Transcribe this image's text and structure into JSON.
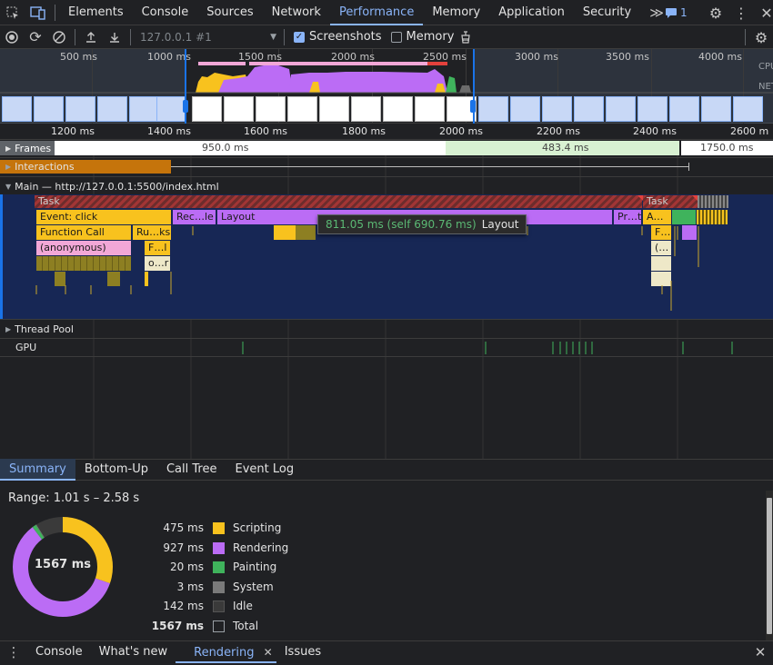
{
  "tabs": {
    "items": [
      "Elements",
      "Console",
      "Sources",
      "Network",
      "Performance",
      "Memory",
      "Application",
      "Security"
    ],
    "more": "≫",
    "issues_count": "1"
  },
  "toolbar": {
    "url": "127.0.0.1 #1",
    "screenshots_label": "Screenshots",
    "memory_label": "Memory",
    "screenshots_checked": true,
    "memory_checked": false
  },
  "overview": {
    "ticks": [
      "500 ms",
      "1000 ms",
      "1500 ms",
      "2000 ms",
      "2500 ms",
      "3000 ms",
      "3500 ms",
      "4000 ms"
    ],
    "cpu_label": "CPU",
    "net_label": "NET"
  },
  "ruler": {
    "ticks": [
      "1200 ms",
      "1400 ms",
      "1600 ms",
      "1800 ms",
      "2000 ms",
      "2200 ms",
      "2400 ms",
      "2600 m"
    ]
  },
  "tracks": {
    "frames": {
      "label": "Frames",
      "values": [
        "950.0 ms",
        "483.4 ms",
        "1750.0 ms"
      ]
    },
    "interactions": {
      "label": "Interactions"
    },
    "main": {
      "label": "Main — http://127.0.0.1:5500/index.html",
      "blocks": {
        "task1": "Task",
        "task2": "Task",
        "event_click": "Event: click",
        "recalc": "Rec…le",
        "layout": "Layout",
        "pr": "Pr…t",
        "a": "A…",
        "function_call": "Function Call",
        "ru": "Ru…ks",
        "f1": "F…",
        "f2": "F…l",
        "anonymous": "(anonymous)",
        "paren": "(…",
        "or": "o…r"
      }
    },
    "tooltip": {
      "time": "811.05 ms (self 690.76 ms)",
      "name": "Layout"
    },
    "thread_pool": {
      "label": "Thread Pool"
    },
    "gpu": {
      "label": "GPU"
    }
  },
  "summary": {
    "tabs": [
      "Summary",
      "Bottom-Up",
      "Call Tree",
      "Event Log"
    ],
    "range": "Range: 1.01 s – 2.58 s",
    "total_center": "1567 ms",
    "legend": [
      {
        "value": "475 ms",
        "label": "Scripting",
        "color": "#f8c21e"
      },
      {
        "value": "927 ms",
        "label": "Rendering",
        "color": "#bb6cf5"
      },
      {
        "value": "20 ms",
        "label": "Painting",
        "color": "#3fb35c"
      },
      {
        "value": "3 ms",
        "label": "System",
        "color": "#7a7a7a"
      },
      {
        "value": "142 ms",
        "label": "Idle",
        "color": "#3a3a3a"
      },
      {
        "value": "1567 ms",
        "label": "Total",
        "color": "transparent"
      }
    ]
  },
  "drawer": {
    "tabs": [
      "Console",
      "What's new",
      "Rendering",
      "Issues"
    ]
  }
}
